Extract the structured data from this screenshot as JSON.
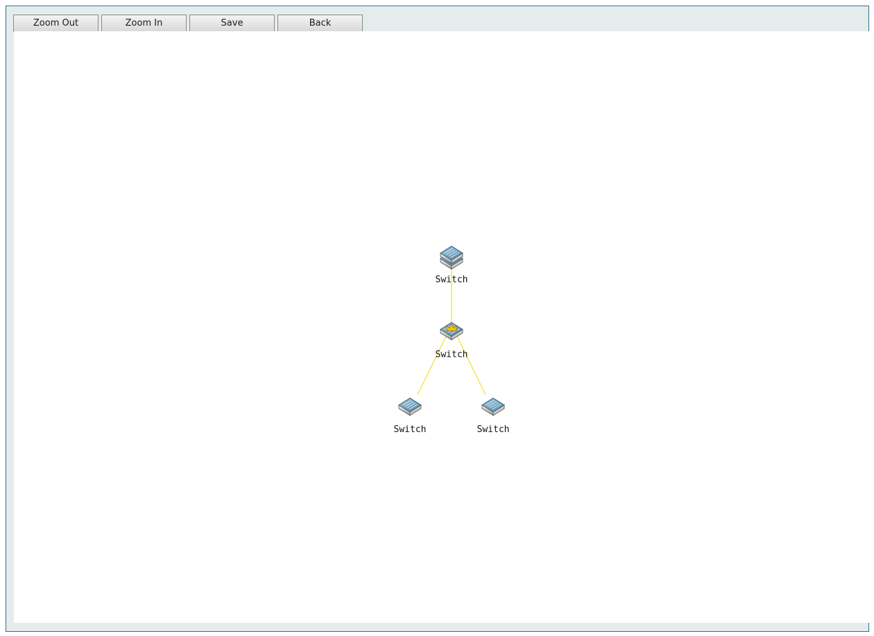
{
  "toolbar": {
    "zoom_out_label": "Zoom Out",
    "zoom_in_label": "Zoom In",
    "save_label": "Save",
    "back_label": "Back"
  },
  "topology": {
    "link_color": "#f2e642",
    "nodes": [
      {
        "id": "sw-top",
        "label": "Switch",
        "icon": "stacked-switch-icon"
      },
      {
        "id": "sw-root",
        "label": "Switch",
        "icon": "root-switch-crown-icon"
      },
      {
        "id": "sw-left",
        "label": "Switch",
        "icon": "switch-icon"
      },
      {
        "id": "sw-right",
        "label": "Switch",
        "icon": "switch-icon"
      }
    ],
    "links": [
      [
        "sw-top",
        "sw-root"
      ],
      [
        "sw-root",
        "sw-left"
      ],
      [
        "sw-root",
        "sw-right"
      ]
    ]
  }
}
